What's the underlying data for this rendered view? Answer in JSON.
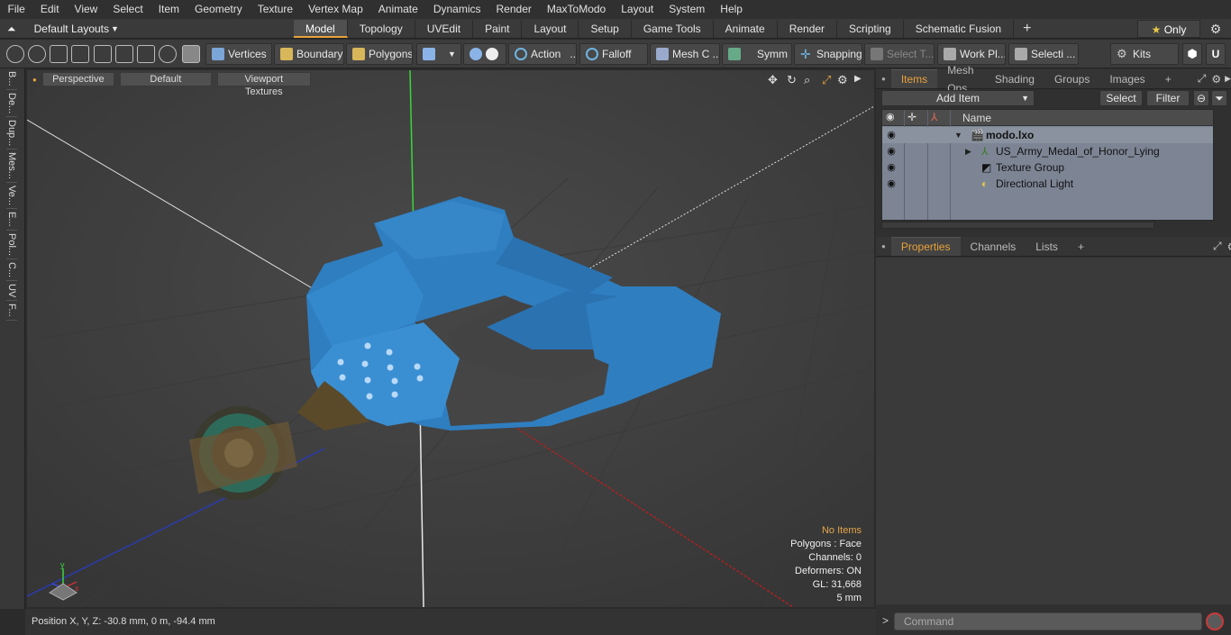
{
  "menu": [
    "File",
    "Edit",
    "View",
    "Select",
    "Item",
    "Geometry",
    "Texture",
    "Vertex Map",
    "Animate",
    "Dynamics",
    "Render",
    "MaxToModo",
    "Layout",
    "System",
    "Help"
  ],
  "layouts_label": "Default Layouts",
  "tabs": [
    "Model",
    "Topology",
    "UVEdit",
    "Paint",
    "Layout",
    "Setup",
    "Game Tools",
    "Animate",
    "Render",
    "Scripting",
    "Schematic Fusion"
  ],
  "only_label": "Only",
  "toolbar": {
    "vertices": "Vertices",
    "boundary": "Boundary",
    "polygons": "Polygons",
    "action": "Action",
    "falloff": "Falloff",
    "mesh_c": "Mesh C ...",
    "symm": "Symm ...",
    "snapping": "Snapping",
    "select_t": "Select T...",
    "work_pl": "Work Pl...",
    "selecti": "Selecti ...",
    "kits": "Kits"
  },
  "left_tabs": [
    "B...",
    "De...",
    "Dup...",
    "Mes...",
    "Ve...",
    "E...",
    "Pol...",
    "C...",
    "UV",
    "F..."
  ],
  "viewport": {
    "perspective": "Perspective",
    "default": "Default",
    "textures": "Viewport Textures",
    "info": {
      "no_items": "No Items",
      "polygons": "Polygons : Face",
      "channels": "Channels: 0",
      "deformers": "Deformers: ON",
      "gl": "GL: 31,668",
      "unit": "5 mm"
    }
  },
  "status": "Position X, Y, Z:   -30.8 mm, 0 m, -94.4 mm",
  "panel_tabs": [
    "Items",
    "Mesh Ops",
    "Shading",
    "Groups",
    "Images"
  ],
  "add_item": "Add Item",
  "select": "Select",
  "filter": "Filter",
  "name_col": "Name",
  "items": [
    {
      "label": "modo.lxo"
    },
    {
      "label": "US_Army_Medal_of_Honor_Lying"
    },
    {
      "label": "Texture Group"
    },
    {
      "label": "Directional Light"
    }
  ],
  "prop_tabs": [
    "Properties",
    "Channels",
    "Lists"
  ],
  "command_placeholder": "Command",
  "colors": {
    "accent": "#e8a23a",
    "ribbon": "#2f7ec0",
    "outliner": "#7d8594"
  }
}
